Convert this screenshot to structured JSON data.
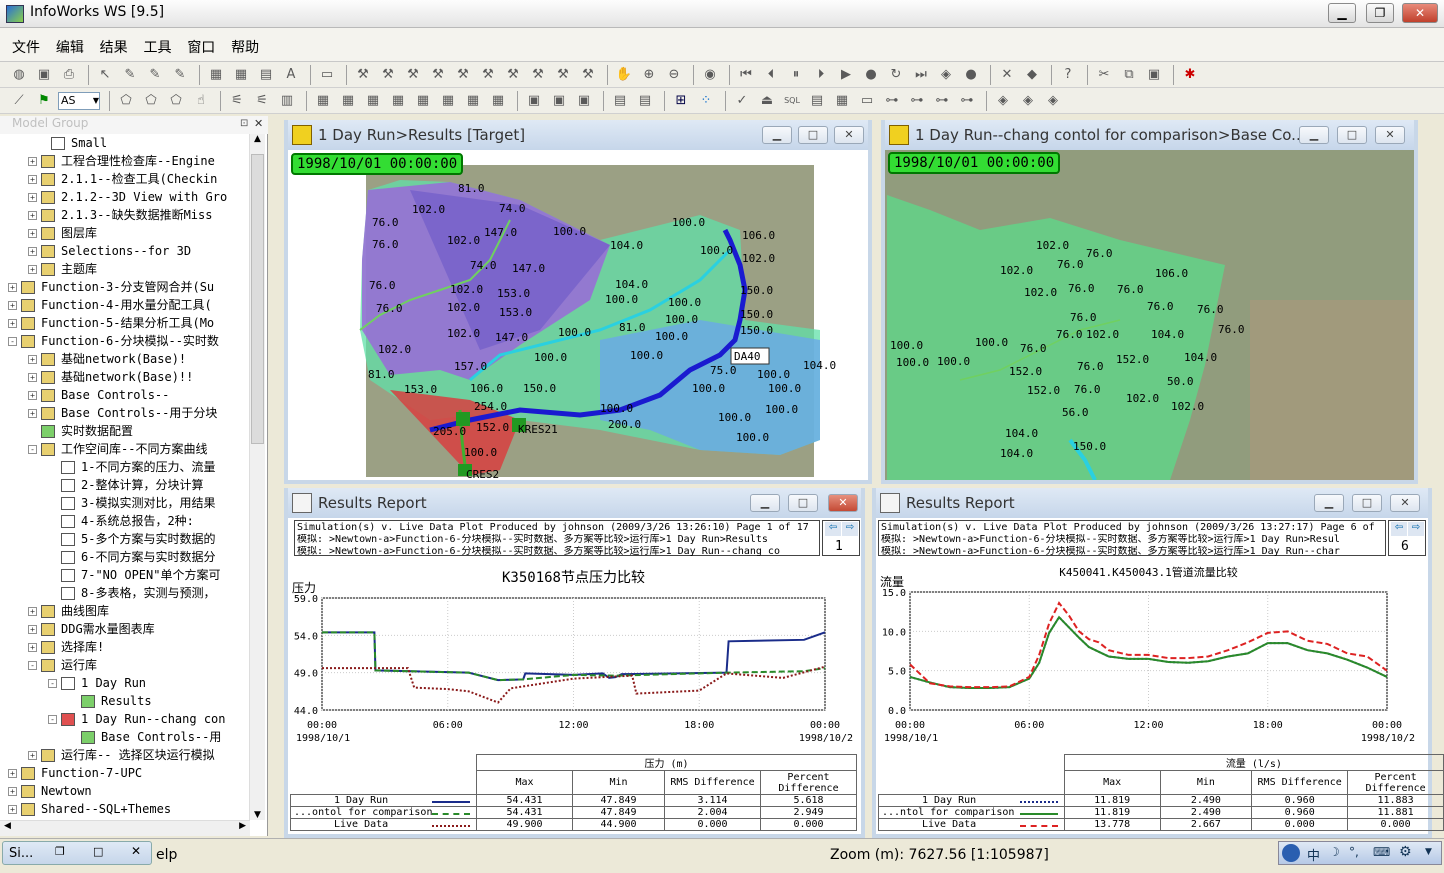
{
  "app": {
    "title": "InfoWorks WS [9.5]"
  },
  "window_controls": {
    "minimize": "▁",
    "restore": "❐",
    "close": "✕"
  },
  "menu": [
    "文件",
    "编辑",
    "结果",
    "工具",
    "窗口",
    "帮助"
  ],
  "toolbar2": {
    "combo": "AS"
  },
  "sidebar": {
    "header": "Model Group",
    "items": [
      {
        "indent": 3,
        "exp": "",
        "icon": "doc",
        "label": "Small"
      },
      {
        "indent": 2,
        "exp": "+",
        "icon": "folder",
        "label": "工程合理性检查库--Engine"
      },
      {
        "indent": 2,
        "exp": "+",
        "icon": "gear",
        "label": "2.1.1--检查工具(Checkin"
      },
      {
        "indent": 2,
        "exp": "+",
        "icon": "gear",
        "label": "2.1.2--3D View with Gro"
      },
      {
        "indent": 2,
        "exp": "+",
        "icon": "gear",
        "label": "2.1.3--缺失数据推断Miss"
      },
      {
        "indent": 2,
        "exp": "+",
        "icon": "folder",
        "label": "图层库"
      },
      {
        "indent": 2,
        "exp": "+",
        "icon": "folder",
        "label": "Selections--for 3D"
      },
      {
        "indent": 2,
        "exp": "+",
        "icon": "folder",
        "label": "主题库"
      },
      {
        "indent": 0,
        "exp": "+",
        "icon": "folder",
        "label": "Function-3-分支管网合并(Su"
      },
      {
        "indent": 0,
        "exp": "+",
        "icon": "folder",
        "label": "Function-4-用水量分配工具("
      },
      {
        "indent": 0,
        "exp": "+",
        "icon": "folder",
        "label": "Function-5-结果分析工具(Mo"
      },
      {
        "indent": 0,
        "exp": "-",
        "icon": "folder",
        "label": "Function-6-分块模拟--实时数"
      },
      {
        "indent": 2,
        "exp": "+",
        "icon": "gear",
        "label": "基础network(Base)!"
      },
      {
        "indent": 2,
        "exp": "+",
        "icon": "gear",
        "label": "基础network(Base)!!"
      },
      {
        "indent": 2,
        "exp": "+",
        "icon": "folder",
        "label": "Base Controls--"
      },
      {
        "indent": 2,
        "exp": "+",
        "icon": "folder",
        "label": "Base Controls--用于分块"
      },
      {
        "indent": 2,
        "exp": "",
        "icon": "grn",
        "label": "实时数据配置"
      },
      {
        "indent": 2,
        "exp": "-",
        "icon": "folder",
        "label": "工作空间库--不同方案曲线"
      },
      {
        "indent": 4,
        "exp": "",
        "icon": "doc",
        "label": "1-不同方案的压力、流量"
      },
      {
        "indent": 4,
        "exp": "",
        "icon": "doc",
        "label": "2-整体计算，分块计算"
      },
      {
        "indent": 4,
        "exp": "",
        "icon": "doc",
        "label": "3-模拟实测对比，用结果"
      },
      {
        "indent": 4,
        "exp": "",
        "icon": "doc",
        "label": "4-系统总报告，2种:"
      },
      {
        "indent": 4,
        "exp": "",
        "icon": "doc",
        "label": "5-多个方案与实时数据的"
      },
      {
        "indent": 4,
        "exp": "",
        "icon": "doc",
        "label": "6-不同方案与实时数据分"
      },
      {
        "indent": 4,
        "exp": "",
        "icon": "doc",
        "label": "7-\"NO OPEN\"单个方案可"
      },
      {
        "indent": 4,
        "exp": "",
        "icon": "doc",
        "label": "8-多表格，实测与预测，"
      },
      {
        "indent": 2,
        "exp": "+",
        "icon": "folder",
        "label": "曲线图库"
      },
      {
        "indent": 2,
        "exp": "+",
        "icon": "folder",
        "label": "DDG需水量图表库"
      },
      {
        "indent": 2,
        "exp": "+",
        "icon": "folder",
        "label": "选择库!"
      },
      {
        "indent": 2,
        "exp": "-",
        "icon": "folder",
        "label": "运行库"
      },
      {
        "indent": 4,
        "exp": "-",
        "icon": "doc",
        "label": "1 Day Run"
      },
      {
        "indent": 6,
        "exp": "",
        "icon": "grn",
        "label": "Results"
      },
      {
        "indent": 4,
        "exp": "-",
        "icon": "red",
        "label": "1 Day Run--chang con"
      },
      {
        "indent": 6,
        "exp": "",
        "icon": "grn",
        "label": "Base Controls--用"
      },
      {
        "indent": 2,
        "exp": "+",
        "icon": "folder",
        "label": "运行库-- 选择区块运行模拟"
      },
      {
        "indent": 0,
        "exp": "+",
        "icon": "folder",
        "label": "Function-7-UPC"
      },
      {
        "indent": 0,
        "exp": "+",
        "icon": "folder",
        "label": "Newtown"
      },
      {
        "indent": 0,
        "exp": "+",
        "icon": "folder",
        "label": "Shared--SQL+Themes"
      }
    ]
  },
  "map1": {
    "title": "1 Day Run>Results  [Target]",
    "time": "1998/10/01 00:00:00",
    "labels": [
      [
        "81.0",
        458,
        192
      ],
      [
        "102.0",
        412,
        213
      ],
      [
        "74.0",
        499,
        212
      ],
      [
        "147.0",
        484,
        236
      ],
      [
        "100.0",
        553,
        235
      ],
      [
        "102.0",
        447,
        244
      ],
      [
        "100.0",
        672,
        226
      ],
      [
        "106.0",
        742,
        239
      ],
      [
        "104.0",
        610,
        249
      ],
      [
        "100.0",
        700,
        254
      ],
      [
        "102.0",
        742,
        262
      ],
      [
        "76.0",
        372,
        226
      ],
      [
        "76.0",
        372,
        248
      ],
      [
        "74.0",
        470,
        269
      ],
      [
        "147.0",
        512,
        272
      ],
      [
        "104.0",
        615,
        288
      ],
      [
        "100.0",
        668,
        306
      ],
      [
        "150.0",
        740,
        294
      ],
      [
        "102.0",
        450,
        293
      ],
      [
        "153.0",
        497,
        297
      ],
      [
        "100.0",
        605,
        303
      ],
      [
        "76.0",
        369,
        289
      ],
      [
        "102.0",
        447,
        311
      ],
      [
        "153.0",
        499,
        316
      ],
      [
        "100.0",
        665,
        323
      ],
      [
        "150.0",
        740,
        318
      ],
      [
        "76.0",
        376,
        312
      ],
      [
        "81.0",
        619,
        331
      ],
      [
        "100.0",
        558,
        336
      ],
      [
        "147.0",
        495,
        341
      ],
      [
        "102.0",
        447,
        337
      ],
      [
        "100.0",
        655,
        340
      ],
      [
        "150.0",
        740,
        334
      ],
      [
        "100.0",
        630,
        359
      ],
      [
        "104.0",
        803,
        369
      ],
      [
        "102.0",
        378,
        353
      ],
      [
        "100.0",
        534,
        361
      ],
      [
        "75.0",
        710,
        374
      ],
      [
        "100.0",
        757,
        378
      ],
      [
        "157.0",
        454,
        370
      ],
      [
        "81.0",
        368,
        378
      ],
      [
        "100.0",
        692,
        392
      ],
      [
        "100.0",
        768,
        392
      ],
      [
        "153.0",
        404,
        393
      ],
      [
        "106.0",
        470,
        392
      ],
      [
        "150.0",
        523,
        392
      ],
      [
        "100.0",
        600,
        412
      ],
      [
        "100.0",
        765,
        413
      ],
      [
        "254.0",
        474,
        410
      ],
      [
        "100.0",
        718,
        421
      ],
      [
        "205.0",
        433,
        435
      ],
      [
        "152.0",
        476,
        431
      ],
      [
        "200.0",
        608,
        428
      ],
      [
        "100.0",
        736,
        441
      ],
      [
        "100.0",
        464,
        456
      ],
      [
        "KRES21",
        518,
        433
      ],
      [
        "CRES2",
        466,
        478
      ]
    ],
    "tag": "DA40"
  },
  "map2": {
    "title": "1 Day Run--chang contol for comparison>Base Co...",
    "time": "1998/10/01 00:00:00",
    "labels": [
      [
        "102.0",
        1036,
        249
      ],
      [
        "76.0",
        1086,
        257
      ],
      [
        "102.0",
        1000,
        274
      ],
      [
        "76.0",
        1057,
        268
      ],
      [
        "106.0",
        1155,
        277
      ],
      [
        "102.0",
        1024,
        296
      ],
      [
        "76.0",
        1068,
        292
      ],
      [
        "76.0",
        1117,
        293
      ],
      [
        "76.0",
        1147,
        310
      ],
      [
        "76.0",
        1197,
        313
      ],
      [
        "76.0",
        1070,
        321
      ],
      [
        "76.0",
        1218,
        333
      ],
      [
        "76.0",
        1056,
        338
      ],
      [
        "102.0",
        1086,
        338
      ],
      [
        "104.0",
        1151,
        338
      ],
      [
        "100.0",
        890,
        349
      ],
      [
        "100.0",
        975,
        346
      ],
      [
        "76.0",
        1020,
        352
      ],
      [
        "152.0",
        1116,
        363
      ],
      [
        "104.0",
        1184,
        361
      ],
      [
        "100.0",
        896,
        366
      ],
      [
        "100.0",
        937,
        365
      ],
      [
        "152.0",
        1009,
        375
      ],
      [
        "76.0",
        1077,
        370
      ],
      [
        "50.0",
        1167,
        385
      ],
      [
        "152.0",
        1027,
        394
      ],
      [
        "76.0",
        1074,
        393
      ],
      [
        "102.0",
        1126,
        402
      ],
      [
        "102.0",
        1171,
        410
      ],
      [
        "56.0",
        1062,
        416
      ],
      [
        "104.0",
        1005,
        437
      ],
      [
        "150.0",
        1073,
        450
      ],
      [
        "104.0",
        1000,
        457
      ]
    ]
  },
  "report1": {
    "title": "Results Report",
    "header": [
      "Simulation(s) v. Live Data Plot Produced by johnson (2009/3/26 13:26:10) Page 1 of 17",
      "模拟: >Newtown-a>Function-6-分块模拟--实时数据、多方案等比较>运行库>1 Day Run>Results",
      "模拟: >Newtown-a>Function-6-分块模拟--实时数据、多方案等比较>运行库>1 Day Run--chang co"
    ],
    "page": "1",
    "table": {
      "group": "压力 (m)",
      "cols": [
        "Max",
        "Min",
        "RMS Difference",
        "Percent Difference"
      ],
      "rows": [
        [
          "1 Day Run",
          "54.431",
          "47.849",
          "3.114",
          "5.618"
        ],
        [
          "...ontol for comparison",
          "54.431",
          "47.849",
          "2.004",
          "2.949"
        ],
        [
          "Live Data",
          "49.900",
          "44.900",
          "0.000",
          "0.000"
        ]
      ]
    }
  },
  "report2": {
    "title": "Results Report",
    "header": [
      "Simulation(s) v. Live Data Plot Produced by johnson (2009/3/26 13:27:17) Page 6 of",
      "模拟: >Newtown-a>Function-6-分块模拟--实时数据、多方案等比较>运行库>1 Day Run>Resul",
      "模拟: >Newtown-a>Function-6-分块模拟--实时数据、多方案等比较>运行库>1 Day Run--char"
    ],
    "page": "6",
    "table": {
      "group": "流量 (l/s)",
      "cols": [
        "Max",
        "Min",
        "RMS Difference",
        "Percent Difference"
      ],
      "rows": [
        [
          "1 Day Run",
          "11.819",
          "2.490",
          "0.960",
          "11.883"
        ],
        [
          "...ntol for comparison",
          "11.819",
          "2.490",
          "0.960",
          "11.881"
        ],
        [
          "Live Data",
          "13.778",
          "2.667",
          "0.000",
          "0.000"
        ]
      ]
    }
  },
  "chart_data": [
    {
      "type": "line",
      "title": "K350168节点压力比较",
      "ylabel": "压力",
      "ylim": [
        44,
        59
      ],
      "yticks": [
        "59.0",
        "54.0",
        "49.0",
        "44.0"
      ],
      "xticks": [
        "00:00",
        "06:00",
        "12:00",
        "18:00",
        "00:00"
      ],
      "xdates": [
        "1998/10/1",
        "1998/10/2"
      ],
      "series": [
        {
          "name": "1 Day Run",
          "color": "#1a2c8a",
          "dash": "",
          "x": [
            0,
            2.5,
            2.55,
            7,
            8.4,
            9.6,
            9.7,
            12,
            13.4,
            13.7,
            14,
            14.3,
            19.3,
            19.4,
            23,
            24
          ],
          "y": [
            54.4,
            54.4,
            49.3,
            49.0,
            48.0,
            48.1,
            48.9,
            48.7,
            48.9,
            48.3,
            48.4,
            48.8,
            49.0,
            53.2,
            53.4,
            54.4
          ]
        },
        {
          "name": "...ontol for comparison",
          "color": "#2a8a2a",
          "dash": "6,3",
          "x": [
            0,
            2.5,
            2.55,
            7,
            8.4,
            9.6,
            12,
            14,
            19.3,
            23,
            24
          ],
          "y": [
            54.4,
            54.4,
            49.3,
            49.0,
            48.0,
            48.1,
            48.7,
            48.6,
            49.0,
            49.2,
            49.6
          ]
        },
        {
          "name": "Live Data",
          "color": "#8a1a1a",
          "dash": "2,2",
          "x": [
            0,
            4.1,
            4.4,
            6,
            7,
            8.4,
            9,
            12,
            14.8,
            15,
            18,
            19.3,
            22,
            24
          ],
          "y": [
            49.6,
            49.6,
            47.0,
            46.8,
            46.5,
            45.0,
            46.9,
            48.2,
            48.6,
            46.2,
            46.6,
            48.9,
            48.3,
            49.8
          ]
        }
      ]
    },
    {
      "type": "line",
      "title": "K450041.K450043.1管道流量比较",
      "ylabel": "流量",
      "ylim": [
        0,
        15
      ],
      "yticks": [
        "15.0",
        "10.0",
        "5.0",
        "0.0"
      ],
      "xticks": [
        "00:00",
        "06:00",
        "12:00",
        "18:00",
        "00:00"
      ],
      "xdates": [
        "1998/10/1",
        "1998/10/2"
      ],
      "series": [
        {
          "name": "1 Day Run",
          "color": "#1a2c8a",
          "dash": "2,2",
          "x": [
            0,
            1,
            2,
            3,
            4,
            5,
            6,
            6.5,
            7,
            7.5,
            8,
            8.5,
            9,
            9.5,
            10,
            11,
            12,
            13,
            14,
            15,
            16,
            17,
            18,
            19,
            20,
            21,
            22,
            23,
            24
          ],
          "y": [
            4.2,
            3.5,
            2.9,
            2.8,
            2.8,
            2.9,
            4.0,
            6.0,
            9.8,
            11.8,
            10.5,
            9.2,
            8.0,
            7.4,
            6.8,
            6.5,
            6.5,
            6.1,
            6.0,
            6.2,
            6.8,
            7.2,
            8.5,
            8.5,
            7.6,
            7.2,
            6.4,
            5.4,
            4.2
          ]
        },
        {
          "name": "...ntol for comparison",
          "color": "#2a8a2a",
          "dash": "",
          "x": [
            0,
            1,
            2,
            3,
            4,
            5,
            6,
            6.5,
            7,
            7.5,
            8,
            8.5,
            9,
            9.5,
            10,
            11,
            12,
            13,
            14,
            15,
            16,
            17,
            18,
            19,
            20,
            21,
            22,
            23,
            24
          ],
          "y": [
            4.2,
            3.5,
            2.9,
            2.8,
            2.8,
            2.9,
            4.0,
            6.0,
            9.8,
            11.8,
            10.5,
            9.2,
            8.0,
            7.4,
            6.8,
            6.5,
            6.5,
            6.1,
            6.0,
            6.2,
            6.8,
            7.2,
            8.5,
            8.5,
            7.6,
            7.2,
            6.4,
            5.4,
            4.2
          ]
        },
        {
          "name": "Live Data",
          "color": "#dd2222",
          "dash": "6,3",
          "x": [
            0,
            1,
            2,
            3,
            4,
            5,
            6,
            6.5,
            7,
            7.5,
            8,
            8.5,
            9,
            9.5,
            10,
            11,
            12,
            13,
            14,
            15,
            16,
            17,
            18,
            19,
            20,
            21,
            22,
            23,
            24
          ],
          "y": [
            5.8,
            3.4,
            3.0,
            2.9,
            2.9,
            3.0,
            4.2,
            7.0,
            11.0,
            13.6,
            12.0,
            10.0,
            9.0,
            8.6,
            7.6,
            7.0,
            7.0,
            6.6,
            6.6,
            6.8,
            7.6,
            8.6,
            9.8,
            10.0,
            8.8,
            8.4,
            7.2,
            6.8,
            5.0
          ]
        }
      ]
    }
  ],
  "status": {
    "left_tab": "Si...",
    "help": "elp",
    "zoom": "Zoom (m): 7627.56 [1:105987]",
    "lang": "中"
  }
}
